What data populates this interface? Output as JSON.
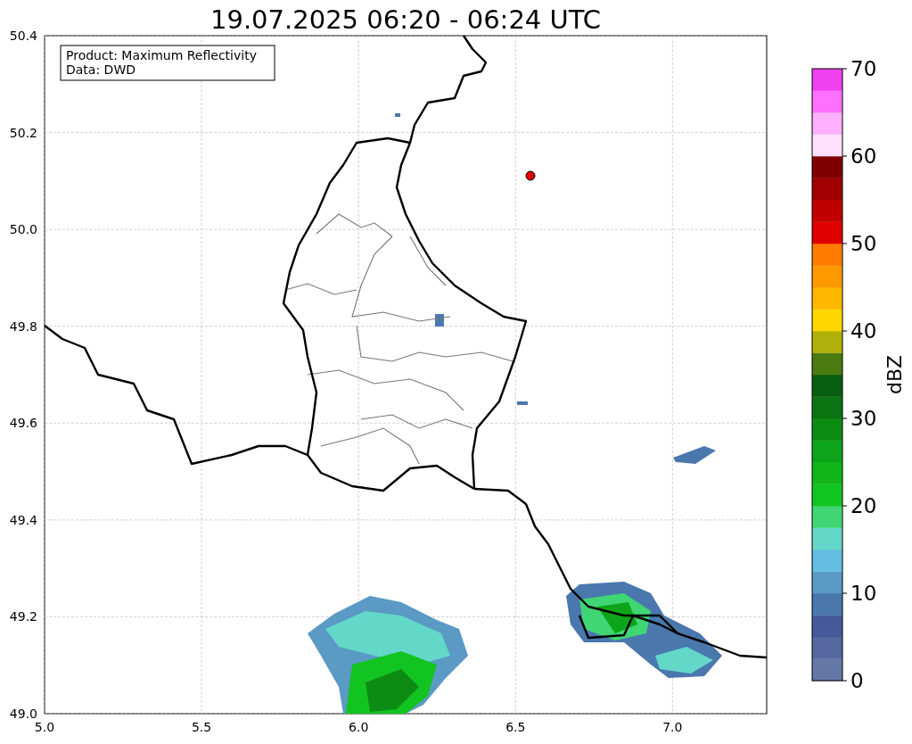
{
  "title": "19.07.2025 06:20 - 06:24 UTC",
  "info_box": [
    "Product: Maximum Reflectivity",
    "Data: DWD"
  ],
  "x_ticks": [
    "5.0",
    "5.5",
    "6.0",
    "6.5",
    "7.0"
  ],
  "y_ticks": [
    "50.4",
    "50.2",
    "50.0",
    "49.8",
    "49.6",
    "49.4",
    "49.2",
    "49.0"
  ],
  "colorbar": {
    "label": "dBZ",
    "ticks": [
      "70",
      "60",
      "50",
      "40",
      "30",
      "20",
      "10",
      "0"
    ],
    "segments": [
      {
        "color": "#6577a6"
      },
      {
        "color": "#56689f"
      },
      {
        "color": "#46599b"
      },
      {
        "color": "#4a78ad"
      },
      {
        "color": "#5a9ac4"
      },
      {
        "color": "#64bde0"
      },
      {
        "color": "#63d7c8"
      },
      {
        "color": "#3fd673"
      },
      {
        "color": "#12c41f"
      },
      {
        "color": "#10b51a"
      },
      {
        "color": "#0ea41a"
      },
      {
        "color": "#0d8c14"
      },
      {
        "color": "#0a7512"
      },
      {
        "color": "#085e10"
      },
      {
        "color": "#4b7a10"
      },
      {
        "color": "#b0b00a"
      },
      {
        "color": "#ffd700"
      },
      {
        "color": "#ffb800"
      },
      {
        "color": "#ff9a00"
      },
      {
        "color": "#ff7c00"
      },
      {
        "color": "#e00000"
      },
      {
        "color": "#c00000"
      },
      {
        "color": "#a00000"
      },
      {
        "color": "#800000"
      },
      {
        "color": "#ffe0ff"
      },
      {
        "color": "#ffb0ff"
      },
      {
        "color": "#ff70ff"
      },
      {
        "color": "#f040f0"
      }
    ]
  }
}
